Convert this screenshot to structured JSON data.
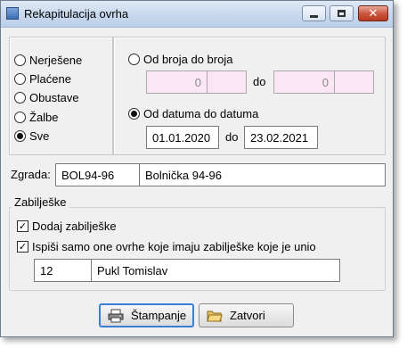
{
  "window": {
    "title": "Rekapitulacija ovrha"
  },
  "status_filter": {
    "options": [
      {
        "label": "Nerješene",
        "checked": false
      },
      {
        "label": "Plaćene",
        "checked": false
      },
      {
        "label": "Obustave",
        "checked": false
      },
      {
        "label": "Žalbe",
        "checked": false
      },
      {
        "label": "Sve",
        "checked": true
      }
    ]
  },
  "range": {
    "by_number": {
      "label": "Od broja do broja",
      "checked": false,
      "from_value": "0",
      "to_label": "do",
      "to_value": "0"
    },
    "by_date": {
      "label": "Od datuma do datuma",
      "checked": true,
      "from_value": "01.01.2020",
      "to_label": "do",
      "to_value": "23.02.2021"
    }
  },
  "building": {
    "label": "Zgrada:",
    "code": "BOL94-96",
    "name": "Bolnička 94-96"
  },
  "notes": {
    "group_label": "Zabilješke",
    "add_notes": {
      "label": "Dodaj zabilješke",
      "checked": true
    },
    "only_with_notes": {
      "label": "Ispiši samo one ovrhe koje imaju zabilješke koje je unio",
      "checked": true
    },
    "user_id": "12",
    "user_name": "Pukl Tomislav"
  },
  "buttons": {
    "print": "Štampanje",
    "close": "Zatvori"
  },
  "colors": {
    "disabled_field_bg": "#fbe7f3",
    "default_button_border": "#3c7fd2"
  },
  "icons": {
    "print": "printer-icon",
    "close": "folder-open-icon"
  }
}
